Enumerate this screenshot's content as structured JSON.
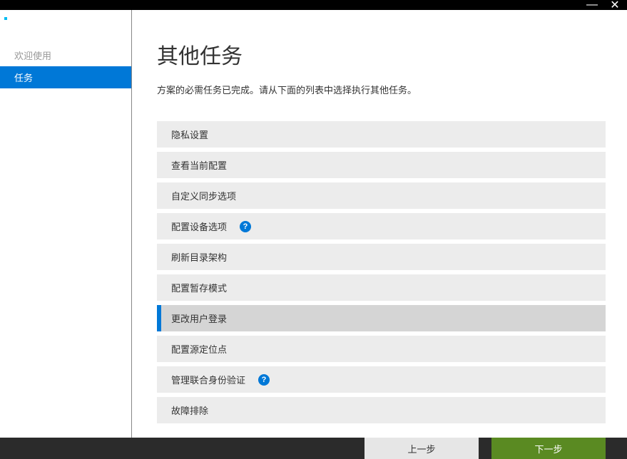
{
  "titlebar": {
    "minimize": "—",
    "close": "✕"
  },
  "sidebar": {
    "items": [
      {
        "label": "欢迎使用",
        "active": false
      },
      {
        "label": "任务",
        "active": true
      }
    ]
  },
  "main": {
    "title": "其他任务",
    "description": "方案的必需任务已完成。请从下面的列表中选择执行其他任务。",
    "tasks": [
      {
        "label": "隐私设置",
        "help": false,
        "selected": false
      },
      {
        "label": "查看当前配置",
        "help": false,
        "selected": false
      },
      {
        "label": "自定义同步选项",
        "help": false,
        "selected": false
      },
      {
        "label": "配置设备选项",
        "help": true,
        "selected": false
      },
      {
        "label": "刷新目录架构",
        "help": false,
        "selected": false
      },
      {
        "label": "配置暂存模式",
        "help": false,
        "selected": false
      },
      {
        "label": "更改用户登录",
        "help": false,
        "selected": true
      },
      {
        "label": "配置源定位点",
        "help": false,
        "selected": false
      },
      {
        "label": "管理联合身份验证",
        "help": true,
        "selected": false
      },
      {
        "label": "故障排除",
        "help": false,
        "selected": false
      }
    ]
  },
  "footer": {
    "prev": "上一步",
    "next": "下一步"
  },
  "help_glyph": "?"
}
